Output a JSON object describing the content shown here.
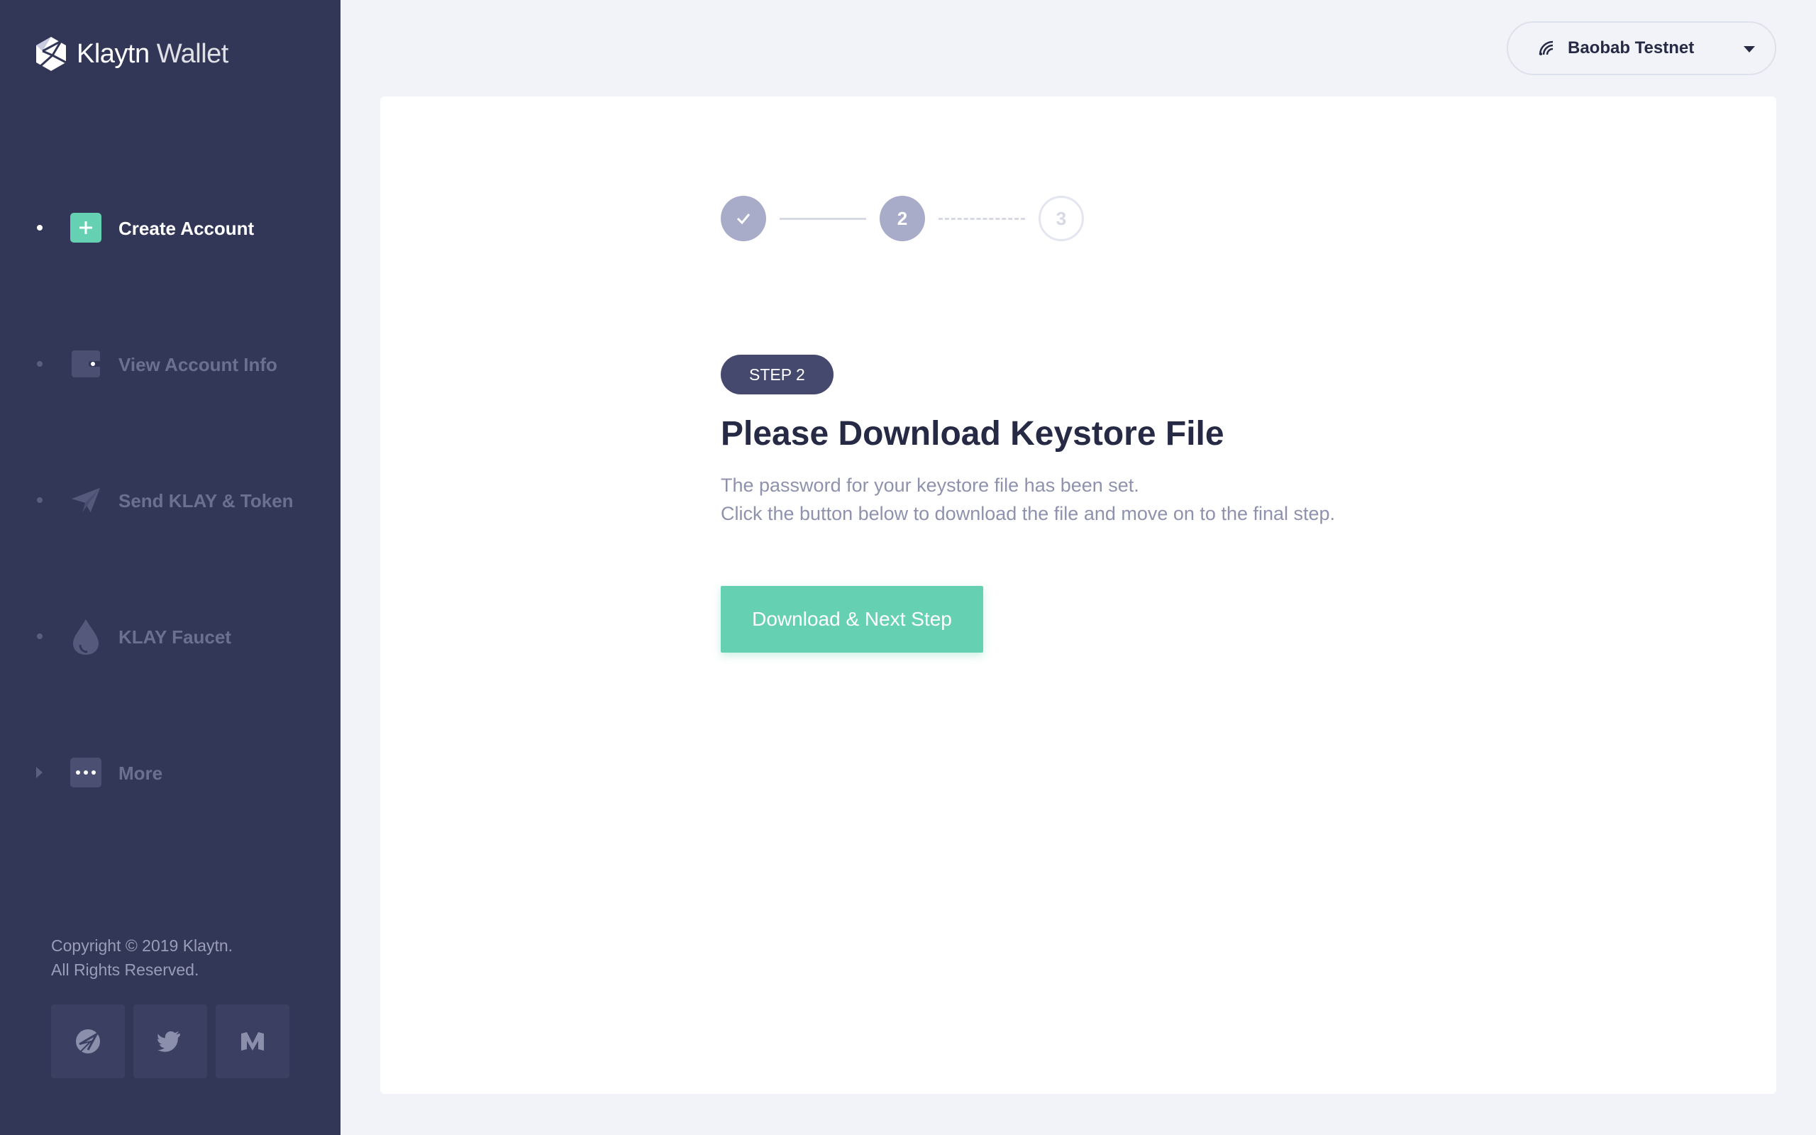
{
  "brand": {
    "name": "Klaytn",
    "suffix": "Wallet"
  },
  "sidebar": {
    "items": [
      {
        "label": "Create Account",
        "icon": "plus-icon",
        "active": true
      },
      {
        "label": "View Account Info",
        "icon": "wallet-icon",
        "active": false
      },
      {
        "label": "Send KLAY & Token",
        "icon": "paper-plane-icon",
        "active": false
      },
      {
        "label": "KLAY Faucet",
        "icon": "drop-icon",
        "active": false
      },
      {
        "label": "More",
        "icon": "more-dots-icon",
        "active": false
      }
    ],
    "copyright_line1": "Copyright © 2019 Klaytn.",
    "copyright_line2": "All Rights Reserved.",
    "social": [
      "klaytn-icon",
      "twitter-icon",
      "medium-icon"
    ]
  },
  "network": {
    "label": "Baobab Testnet",
    "icon": "signal-icon"
  },
  "stepper": {
    "step2": "2",
    "step3": "3",
    "current": 2
  },
  "main": {
    "badge": "STEP 2",
    "title": "Please Download Keystore File",
    "desc_line1": "The password for your keystore file has been set.",
    "desc_line2": "Click the button below to download the file and move on to the final step.",
    "button_label": "Download & Next Step"
  },
  "colors": {
    "sidebar_bg": "#333757",
    "accent": "#66d0b3",
    "badge_bg": "#44496d",
    "heading": "#262a44",
    "muted": "#8e92ad"
  }
}
